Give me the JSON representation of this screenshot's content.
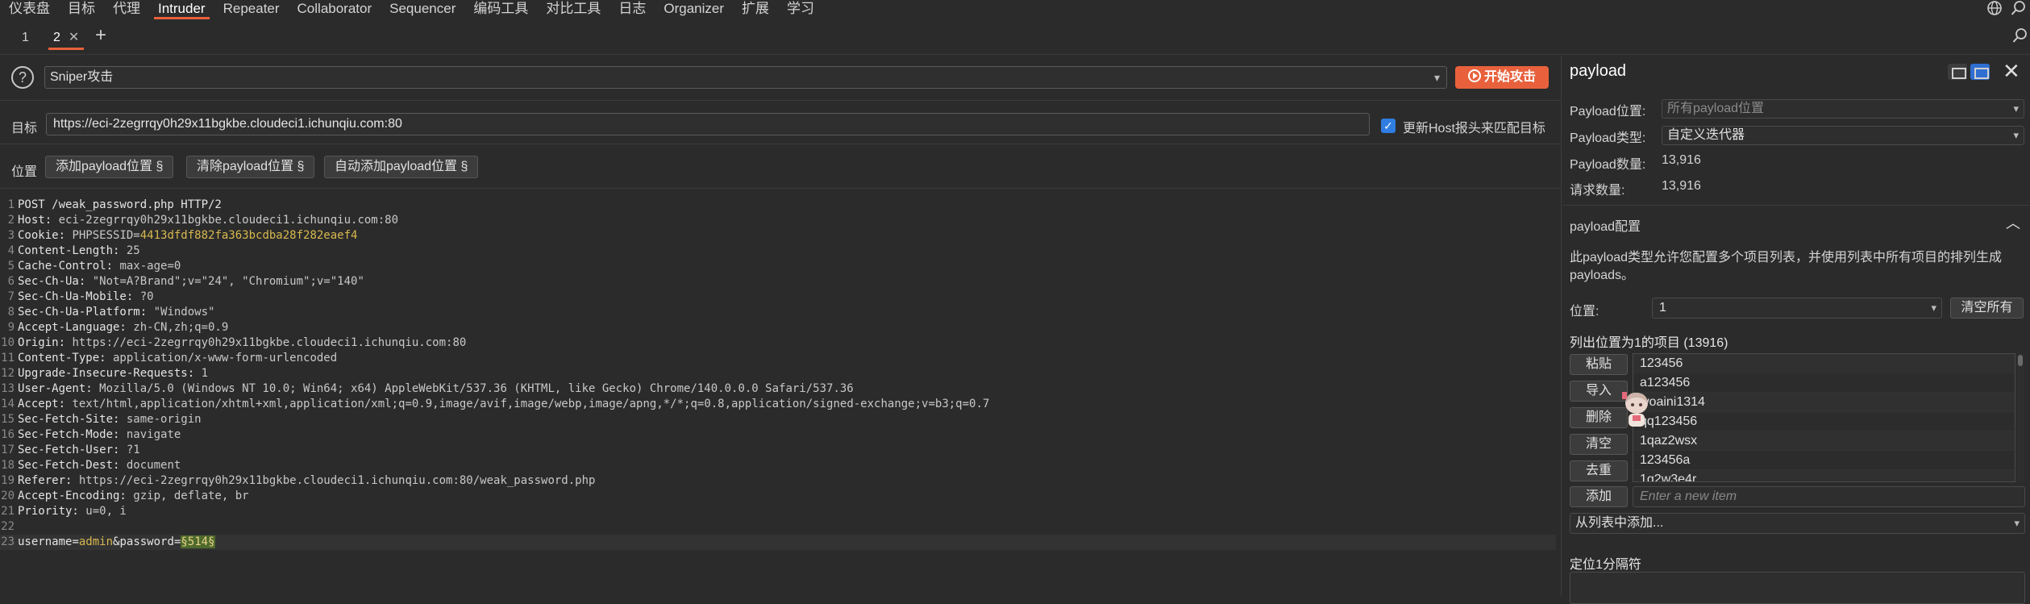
{
  "menubar": {
    "items": [
      "仪表盘",
      "目标",
      "代理",
      "Intruder",
      "Repeater",
      "Collaborator",
      "Sequencer",
      "编码工具",
      "对比工具",
      "日志",
      "Organizer",
      "扩展",
      "学习"
    ],
    "active": "Intruder",
    "icons": [
      "globe-icon",
      "search-icon"
    ]
  },
  "tabs": {
    "items": [
      {
        "label": "1"
      },
      {
        "label": "2",
        "closable": true,
        "active": true
      }
    ],
    "add_icon": "plus-icon"
  },
  "attack": {
    "type": "Sniper攻击",
    "start_label": "开始攻击"
  },
  "target": {
    "label": "目标",
    "url": "https://eci-2zegrrqy0h29x11bgkbe.cloudeci1.ichunqiu.com:80",
    "checkbox_checked": true,
    "checkbox_label": "更新Host报头来匹配目标"
  },
  "positions": {
    "label": "位置",
    "add_label": "添加payload位置 §",
    "clear_label": "清除payload位置 §",
    "auto_label": "自动添加payload位置 §"
  },
  "request": {
    "lines": [
      {
        "n": "1",
        "text": "POST /weak_password.php HTTP/2"
      },
      {
        "n": "2",
        "key": "Host:",
        "val": " eci-2zegrrqy0h29x11bgkbe.cloudeci1.ichunqiu.com:80"
      },
      {
        "n": "3",
        "key": "Cookie:",
        "val": " PHPSESSID=",
        "cookie": "4413dfdf882fa363bcdba28f282eaef4"
      },
      {
        "n": "4",
        "key": "Content-Length:",
        "val": " 25"
      },
      {
        "n": "5",
        "key": "Cache-Control:",
        "val": " max-age=0"
      },
      {
        "n": "6",
        "key": "Sec-Ch-Ua:",
        "val": " \"Not=A?Brand\";v=\"24\", \"Chromium\";v=\"140\""
      },
      {
        "n": "7",
        "key": "Sec-Ch-Ua-Mobile:",
        "val": " ?0"
      },
      {
        "n": "8",
        "key": "Sec-Ch-Ua-Platform:",
        "val": " \"Windows\""
      },
      {
        "n": "9",
        "key": "Accept-Language:",
        "val": " zh-CN,zh;q=0.9"
      },
      {
        "n": "10",
        "key": "Origin:",
        "val": " https://eci-2zegrrqy0h29x11bgkbe.cloudeci1.ichunqiu.com:80"
      },
      {
        "n": "11",
        "key": "Content-Type:",
        "val": " application/x-www-form-urlencoded"
      },
      {
        "n": "12",
        "key": "Upgrade-Insecure-Requests:",
        "val": " 1"
      },
      {
        "n": "13",
        "key": "User-Agent:",
        "val": " Mozilla/5.0 (Windows NT 10.0; Win64; x64) AppleWebKit/537.36 (KHTML, like Gecko) Chrome/140.0.0.0 Safari/537.36"
      },
      {
        "n": "14",
        "key": "Accept:",
        "val": " text/html,application/xhtml+xml,application/xml;q=0.9,image/avif,image/webp,image/apng,*/*;q=0.8,application/signed-exchange;v=b3;q=0.7"
      },
      {
        "n": "15",
        "key": "Sec-Fetch-Site:",
        "val": " same-origin"
      },
      {
        "n": "16",
        "key": "Sec-Fetch-Mode:",
        "val": " navigate"
      },
      {
        "n": "17",
        "key": "Sec-Fetch-User:",
        "val": " ?1"
      },
      {
        "n": "18",
        "key": "Sec-Fetch-Dest:",
        "val": " document"
      },
      {
        "n": "19",
        "key": "Referer:",
        "val": " https://eci-2zegrrqy0h29x11bgkbe.cloudeci1.ichunqiu.com:80/weak_password.php"
      },
      {
        "n": "20",
        "key": "Accept-Encoding:",
        "val": " gzip, deflate, br"
      },
      {
        "n": "21",
        "key": "Priority:",
        "val": " u=0, i"
      },
      {
        "n": "22",
        "text": ""
      },
      {
        "n": "23",
        "body": true,
        "p1": "username",
        "eq1": "=",
        "v1": "admin",
        "amp": "&",
        "p2": "password",
        "eq2": "=",
        "marker": "§514§"
      }
    ]
  },
  "payload_panel": {
    "title": "payload",
    "position_label": "Payload位置:",
    "position_value": "所有payload位置",
    "type_label": "Payload类型:",
    "type_value": "自定义迭代器",
    "count_label": "Payload数量:",
    "count_value": "13,916",
    "request_label": "请求数量:",
    "request_value": "13,916",
    "config_title": "payload配置",
    "config_desc": "此payload类型允许您配置多个项目列表，并使用列表中所有项目的排列生成payloads。",
    "pos_label": "位置:",
    "pos_value": "1",
    "clear_all": "清空所有",
    "list_title": "列出位置为1的项目 (13916)",
    "buttons": [
      "粘贴",
      "导入",
      "删除",
      "清空",
      "去重"
    ],
    "items": [
      "123456",
      "a123456",
      "woaini1314",
      "qq123456",
      "1qaz2wsx",
      "123456a",
      "1q2w3e4r"
    ],
    "add_label": "添加",
    "new_item_placeholder": "Enter a new item",
    "from_list": "从列表中添加...",
    "separator_title": "定位1分隔符"
  },
  "colors": {
    "accent": "#e8613c",
    "checkbox": "#2f7de1",
    "cookie_value": "#d8b84f",
    "marker_bg": "#4f6a2c"
  }
}
